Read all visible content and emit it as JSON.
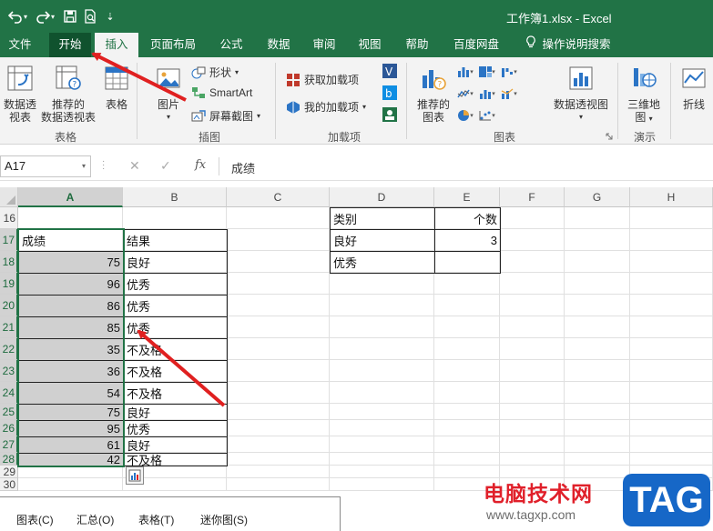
{
  "window": {
    "title": "工作簿1.xlsx  -  Excel"
  },
  "qat": {
    "caret": "▾",
    "more": "⇣"
  },
  "tabs": [
    {
      "label": "文件"
    },
    {
      "label": "开始"
    },
    {
      "label": "插入"
    },
    {
      "label": "页面布局"
    },
    {
      "label": "公式"
    },
    {
      "label": "数据"
    },
    {
      "label": "审阅"
    },
    {
      "label": "视图"
    },
    {
      "label": "帮助"
    },
    {
      "label": "百度网盘"
    },
    {
      "label": "操作说明搜索"
    }
  ],
  "ribbon": {
    "pivot_line1": "数据透",
    "pivot_line2": "视表",
    "rec_pivot_line1": "推荐的",
    "rec_pivot_line2": "数据透视表",
    "table": "表格",
    "group_tables": "表格",
    "picture": "图片",
    "shapes": "形状",
    "smartart": "SmartArt",
    "screenshot": "屏幕截图",
    "group_illustrations": "插图",
    "get_addins": "获取加载项",
    "my_addins": "我的加载项",
    "group_addins": "加载项",
    "rec_charts_line1": "推荐的",
    "rec_charts_line2": "图表",
    "pivot_chart": "数据透视图",
    "group_charts": "图表",
    "map3d_line1": "三维地",
    "map3d_line2": "图",
    "group_tours": "演示",
    "sparkline": "折线",
    "caret": "▾"
  },
  "formula_bar": {
    "name_box": "A17",
    "cancel": "✕",
    "enter": "✓",
    "fx": "fx",
    "content": "成绩"
  },
  "columns": [
    "A",
    "B",
    "C",
    "D",
    "E",
    "F",
    "G",
    "H"
  ],
  "rows": [
    "16",
    "17",
    "18",
    "19",
    "20",
    "21",
    "22",
    "23",
    "24",
    "25",
    "26",
    "27",
    "28",
    "29",
    "30"
  ],
  "data_table": [
    {
      "score": "成绩",
      "result": "结果"
    },
    {
      "score": "75",
      "result": "良好"
    },
    {
      "score": "96",
      "result": "优秀"
    },
    {
      "score": "86",
      "result": "优秀"
    },
    {
      "score": "85",
      "result": "优秀"
    },
    {
      "score": "35",
      "result": "不及格"
    },
    {
      "score": "36",
      "result": "不及格"
    },
    {
      "score": "54",
      "result": "不及格"
    },
    {
      "score": "75",
      "result": "良好"
    },
    {
      "score": "95",
      "result": "优秀"
    },
    {
      "score": "61",
      "result": "良好"
    },
    {
      "score": "42",
      "result": "不及格"
    }
  ],
  "summary_table": {
    "header": {
      "category": "类别",
      "count": "个数"
    },
    "rows": [
      {
        "category": "良好",
        "count": "3"
      },
      {
        "category": "优秀",
        "count": ""
      }
    ]
  },
  "quick_analysis": {
    "tabs": [
      "图表(C)",
      "汇总(O)",
      "表格(T)",
      "迷你图(S)"
    ]
  },
  "watermark": {
    "site_name": "电脑技术网",
    "url": "www.tagxp.com",
    "logo": "TAG"
  },
  "colors": {
    "excel_green": "#217346",
    "selection_shade": "#d0d0d0",
    "arrow_red": "#e02020"
  }
}
